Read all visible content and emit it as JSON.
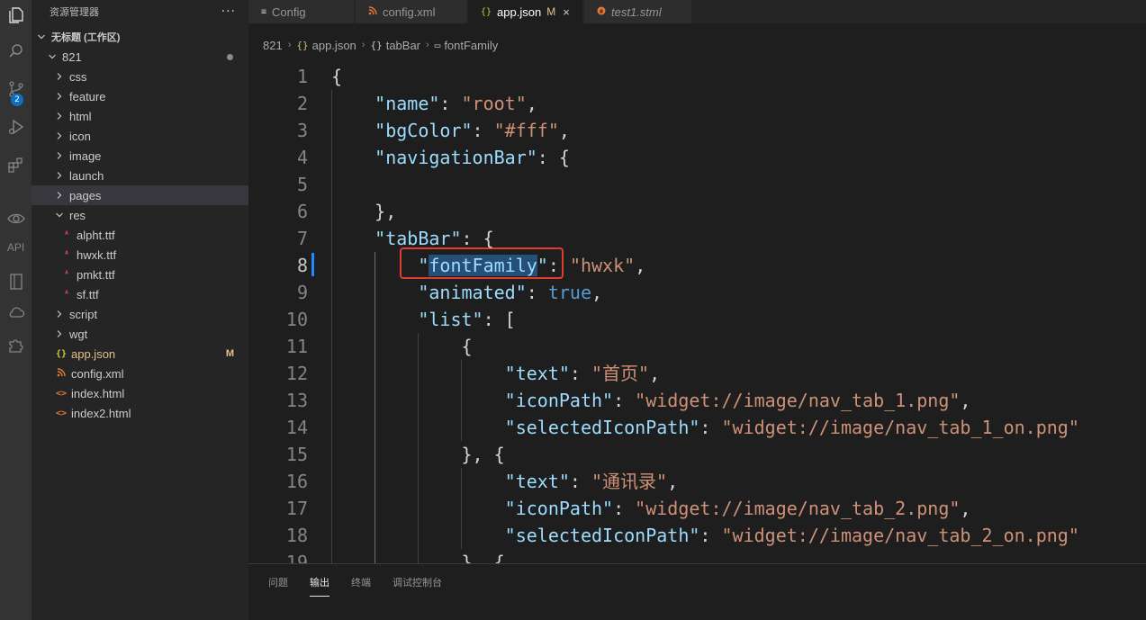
{
  "sidebar": {
    "title": "资源管理器",
    "more": "···",
    "workspace": "无标题 (工作区)",
    "project": "821",
    "items": [
      {
        "label": "css",
        "type": "folder"
      },
      {
        "label": "feature",
        "type": "folder"
      },
      {
        "label": "html",
        "type": "folder"
      },
      {
        "label": "icon",
        "type": "folder"
      },
      {
        "label": "image",
        "type": "folder"
      },
      {
        "label": "launch",
        "type": "folder"
      },
      {
        "label": "pages",
        "type": "folder",
        "selected": true
      },
      {
        "label": "res",
        "type": "folder-open"
      },
      {
        "label": "alpht.ttf",
        "type": "font"
      },
      {
        "label": "hwxk.ttf",
        "type": "font"
      },
      {
        "label": "pmkt.ttf",
        "type": "font"
      },
      {
        "label": "sf.ttf",
        "type": "font"
      },
      {
        "label": "script",
        "type": "folder"
      },
      {
        "label": "wgt",
        "type": "folder"
      },
      {
        "label": "app.json",
        "type": "json",
        "status": "M"
      },
      {
        "label": "config.xml",
        "type": "xml"
      },
      {
        "label": "index.html",
        "type": "html"
      },
      {
        "label": "index2.html",
        "type": "html"
      }
    ]
  },
  "activity_badge": "2",
  "activity_api": "API",
  "tabs": [
    {
      "label": "Config",
      "icon": "≡"
    },
    {
      "label": "config.xml",
      "icon": "rss"
    },
    {
      "label": "app.json",
      "icon": "{}",
      "status": "M",
      "close": "×"
    },
    {
      "label": "test1.stml",
      "icon": "s"
    }
  ],
  "breadcrumb": {
    "project": "821",
    "file": "app.json",
    "obj": "tabBar",
    "prop": "fontFamily"
  },
  "code_lines": [
    {
      "n": "1",
      "t": [
        {
          "c": "p",
          "v": "{"
        }
      ]
    },
    {
      "n": "2",
      "t": [
        {
          "c": "p",
          "v": "    "
        },
        {
          "c": "k",
          "v": "\"name\""
        },
        {
          "c": "p",
          "v": ": "
        },
        {
          "c": "s",
          "v": "\"root\""
        },
        {
          "c": "p",
          "v": ","
        }
      ]
    },
    {
      "n": "3",
      "t": [
        {
          "c": "p",
          "v": "    "
        },
        {
          "c": "k",
          "v": "\"bgColor\""
        },
        {
          "c": "p",
          "v": ": "
        },
        {
          "c": "s",
          "v": "\"#fff\""
        },
        {
          "c": "p",
          "v": ","
        }
      ]
    },
    {
      "n": "4",
      "t": [
        {
          "c": "p",
          "v": "    "
        },
        {
          "c": "k",
          "v": "\"navigationBar\""
        },
        {
          "c": "p",
          "v": ": {"
        }
      ]
    },
    {
      "n": "5",
      "t": [
        {
          "c": "p",
          "v": ""
        }
      ]
    },
    {
      "n": "6",
      "t": [
        {
          "c": "p",
          "v": "    },"
        }
      ]
    },
    {
      "n": "7",
      "t": [
        {
          "c": "p",
          "v": "    "
        },
        {
          "c": "k",
          "v": "\"tabBar\""
        },
        {
          "c": "p",
          "v": ": {"
        }
      ]
    },
    {
      "n": "8",
      "t": [
        {
          "c": "p",
          "v": "        "
        },
        {
          "c": "k",
          "v": "\""
        },
        {
          "c": "kh",
          "v": "fontFamily"
        },
        {
          "c": "k",
          "v": "\""
        },
        {
          "c": "p",
          "v": ": "
        },
        {
          "c": "s",
          "v": "\"hwxk\""
        },
        {
          "c": "p",
          "v": ","
        }
      ]
    },
    {
      "n": "9",
      "t": [
        {
          "c": "p",
          "v": "        "
        },
        {
          "c": "k",
          "v": "\"animated\""
        },
        {
          "c": "p",
          "v": ": "
        },
        {
          "c": "b",
          "v": "true"
        },
        {
          "c": "p",
          "v": ","
        }
      ]
    },
    {
      "n": "10",
      "t": [
        {
          "c": "p",
          "v": "        "
        },
        {
          "c": "k",
          "v": "\"list\""
        },
        {
          "c": "p",
          "v": ": ["
        }
      ]
    },
    {
      "n": "11",
      "t": [
        {
          "c": "p",
          "v": "            {"
        }
      ]
    },
    {
      "n": "12",
      "t": [
        {
          "c": "p",
          "v": "                "
        },
        {
          "c": "k",
          "v": "\"text\""
        },
        {
          "c": "p",
          "v": ": "
        },
        {
          "c": "s",
          "v": "\"首页\""
        },
        {
          "c": "p",
          "v": ","
        }
      ]
    },
    {
      "n": "13",
      "t": [
        {
          "c": "p",
          "v": "                "
        },
        {
          "c": "k",
          "v": "\"iconPath\""
        },
        {
          "c": "p",
          "v": ": "
        },
        {
          "c": "s",
          "v": "\"widget://image/nav_tab_1.png\""
        },
        {
          "c": "p",
          "v": ","
        }
      ]
    },
    {
      "n": "14",
      "t": [
        {
          "c": "p",
          "v": "                "
        },
        {
          "c": "k",
          "v": "\"selectedIconPath\""
        },
        {
          "c": "p",
          "v": ": "
        },
        {
          "c": "s",
          "v": "\"widget://image/nav_tab_1_on.png\""
        }
      ]
    },
    {
      "n": "15",
      "t": [
        {
          "c": "p",
          "v": "            }, {"
        }
      ]
    },
    {
      "n": "16",
      "t": [
        {
          "c": "p",
          "v": "                "
        },
        {
          "c": "k",
          "v": "\"text\""
        },
        {
          "c": "p",
          "v": ": "
        },
        {
          "c": "s",
          "v": "\"通讯录\""
        },
        {
          "c": "p",
          "v": ","
        }
      ]
    },
    {
      "n": "17",
      "t": [
        {
          "c": "p",
          "v": "                "
        },
        {
          "c": "k",
          "v": "\"iconPath\""
        },
        {
          "c": "p",
          "v": ": "
        },
        {
          "c": "s",
          "v": "\"widget://image/nav_tab_2.png\""
        },
        {
          "c": "p",
          "v": ","
        }
      ]
    },
    {
      "n": "18",
      "t": [
        {
          "c": "p",
          "v": "                "
        },
        {
          "c": "k",
          "v": "\"selectedIconPath\""
        },
        {
          "c": "p",
          "v": ": "
        },
        {
          "c": "s",
          "v": "\"widget://image/nav_tab_2_on.png\""
        }
      ]
    },
    {
      "n": "19",
      "t": [
        {
          "c": "p",
          "v": "            }, {"
        }
      ]
    }
  ],
  "panel": {
    "tabs": [
      "问题",
      "输出",
      "终端",
      "调试控制台"
    ],
    "active": "输出"
  },
  "colors": {
    "key": "#9cdcfe",
    "string": "#ce9178",
    "boolean": "#569cd6",
    "highlight_box": "#e03d31",
    "modified": "#e2c08d"
  }
}
